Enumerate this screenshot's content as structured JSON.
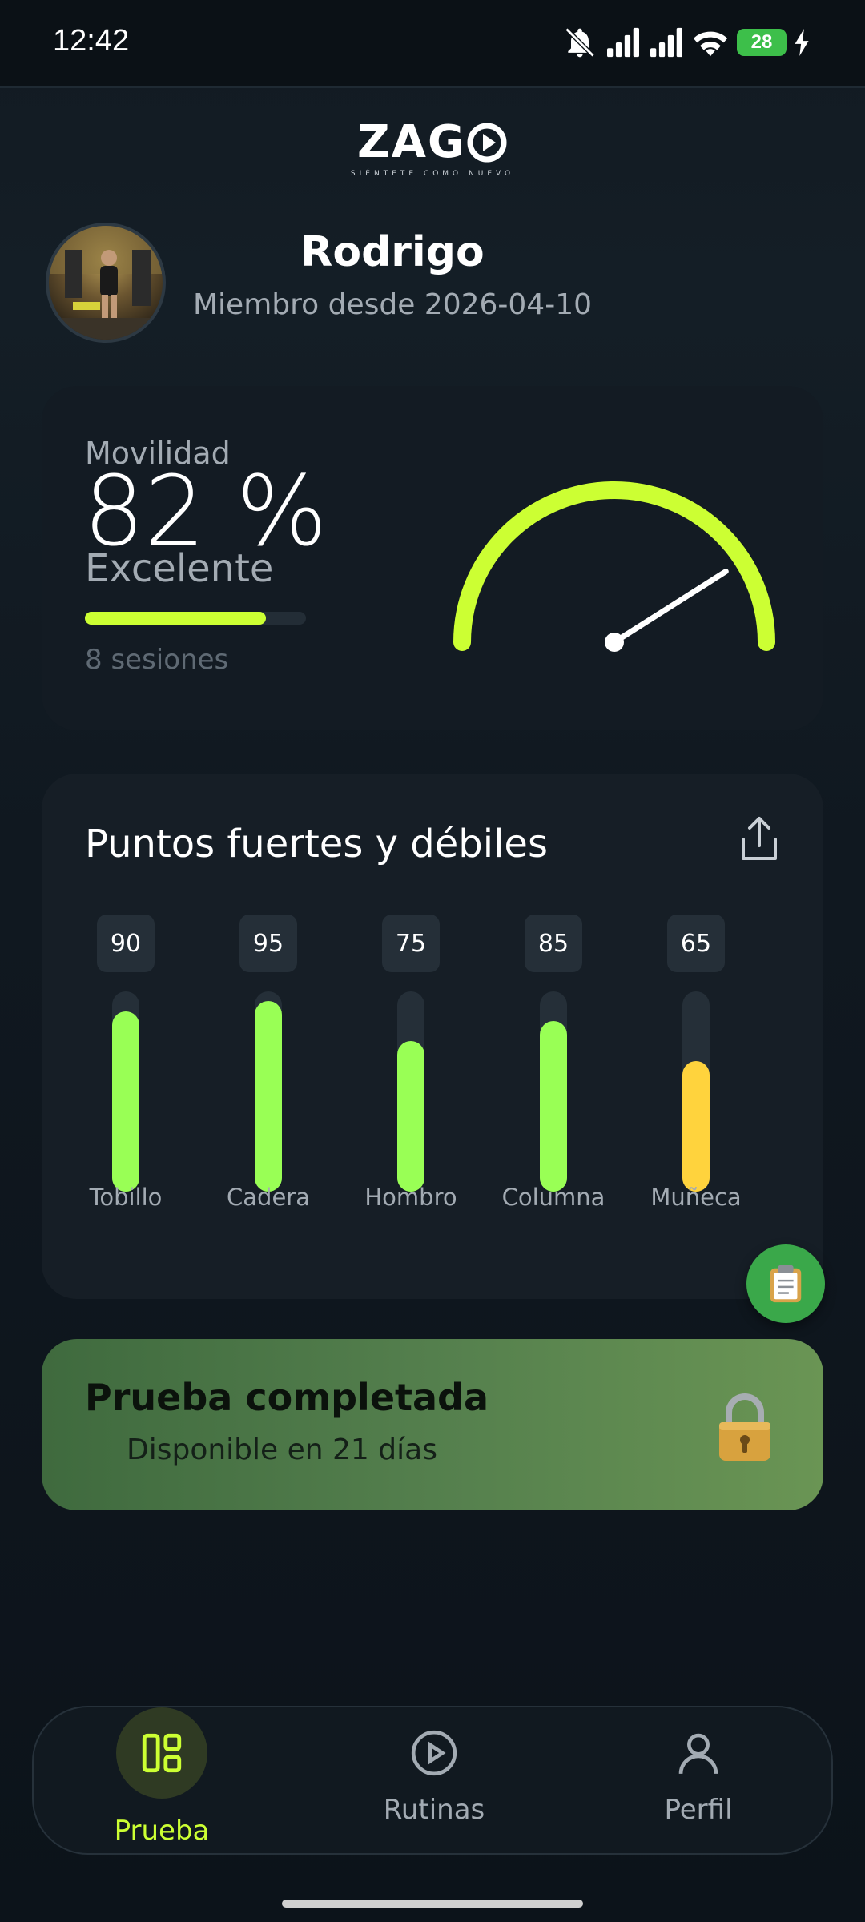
{
  "status_bar": {
    "time": "12:42",
    "battery": "28",
    "icons": [
      "bell-off-icon",
      "signal-icon",
      "signal-icon",
      "wifi-icon",
      "battery-icon",
      "charging-icon"
    ]
  },
  "brand": {
    "name": "ZAG",
    "tagline": "SIÉNTETE COMO NUEVO",
    "accent": "#ccff33"
  },
  "profile": {
    "name": "Rodrigo",
    "member_since": "Miembro desde 2026-04-10"
  },
  "mobility": {
    "label": "Movilidad",
    "value": "82 %",
    "value_fraction": 0.82,
    "status": "Excelente",
    "progress_fraction": 0.82,
    "sessions": "8 sesiones"
  },
  "strengths": {
    "title": "Puntos fuertes y débiles",
    "share_icon": "share-icon",
    "items": [
      {
        "label": "Tobillo",
        "value": "90",
        "score": 90,
        "color": "#99ff55"
      },
      {
        "label": "Cadera",
        "value": "95",
        "score": 95,
        "color": "#99ff55"
      },
      {
        "label": "Hombro",
        "value": "75",
        "score": 75,
        "color": "#99ff55"
      },
      {
        "label": "Columna",
        "value": "85",
        "score": 85,
        "color": "#99ff55"
      },
      {
        "label": "Muñeca",
        "value": "65",
        "score": 65,
        "color": "#ffd33d"
      }
    ]
  },
  "fab": {
    "icon": "clipboard-icon"
  },
  "test_banner": {
    "title": "Prueba completada",
    "subtitle": "Disponible en 21 días",
    "icon": "lock-icon"
  },
  "nav": {
    "items": [
      {
        "label": "Prueba",
        "icon": "dashboard-icon",
        "active": true
      },
      {
        "label": "Rutinas",
        "icon": "play-circle-icon",
        "active": false
      },
      {
        "label": "Perfil",
        "icon": "user-icon",
        "active": false
      }
    ]
  }
}
